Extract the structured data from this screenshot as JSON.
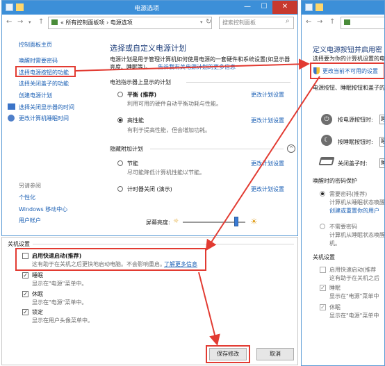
{
  "main_window": {
    "title": "电源选项",
    "breadcrumb": "« 所有控制面板项 › 电源选项",
    "search_placeholder": "搜索控制面板",
    "sidebar": {
      "home": "控制面板主页",
      "items": [
        "唤醒时需要密码",
        "选择电源按钮的功能",
        "选择关闭盖子的功能",
        "创建电源计划",
        "选择关闭显示器的时间",
        "更改计算机睡眠时间"
      ],
      "see_also": "另请参阅",
      "see_also_items": [
        "个性化",
        "Windows 移动中心",
        "用户帐户"
      ]
    },
    "content": {
      "heading": "选择或自定义电源计划",
      "desc_line1": "电源计划是用于管理计算机如何使用电源的一套硬件和系统设置(如显示器",
      "desc_line2": "亮度、睡眠等)。",
      "desc_link": "告诉我有关电源计划的更多信息",
      "section_shown": "电池指示器上显示的计划",
      "section_hidden": "隐藏附加计划",
      "change_settings": "更改计划设置",
      "plans": [
        {
          "name": "平衡 (推荐)",
          "desc": "利用可用的硬件自动平衡功耗与性能。",
          "selected": false
        },
        {
          "name": "高性能",
          "desc": "有利于提高性能，但会增加功耗。",
          "selected": true
        },
        {
          "name": "节能",
          "desc": "尽可能降低计算机性能以节能。",
          "selected": false
        },
        {
          "name": "计时器关闭 (演示)",
          "desc": "",
          "selected": false
        }
      ],
      "brightness_label": "屏幕亮度:",
      "brightness_level": 0.86
    }
  },
  "shutdown_settings": {
    "title": "关机设置",
    "items": [
      {
        "label": "启用快速启动(推荐)",
        "desc": "这有助于在关机之后更快地启动电脑。不会影响重启。",
        "link": "了解更多信息",
        "checked": false
      },
      {
        "label": "睡眠",
        "desc": "显示在\"电源\"菜单中。",
        "checked": true
      },
      {
        "label": "休眠",
        "desc": "显示在\"电源\"菜单中。",
        "checked": true
      },
      {
        "label": "锁定",
        "desc": "显示在用户头像菜单中。",
        "checked": true
      }
    ],
    "save_button": "保存修改",
    "cancel_button": "取消"
  },
  "right_window": {
    "heading_line1": "定义电源按钮并启用密",
    "heading_line2": "选择要为你的计算机设置的电源",
    "admin_link": "更改当前不可用的设置",
    "section_line": "电源按钮、睡眠按钮和盖子的",
    "rows": [
      "按电源按钮时:",
      "按睡眠按钮时:",
      "关闭盖子时:"
    ],
    "password_title": "唤醒时的密码保护",
    "password_required": "需要密码(推荐)",
    "password_required_desc1": "计算机从睡眠状态唤醒",
    "password_required_desc2": "创建或重置你的用户",
    "password_none": "不需要密码",
    "password_none_desc1": "计算机从睡眠状态唤醒",
    "password_none_desc2": "机。",
    "shutdown_title": "关机设置",
    "shutdown_items": [
      {
        "label": "启用快速启动(推荐",
        "desc": "这有助于在关机之后",
        "checked": false
      },
      {
        "label": "睡眠",
        "desc": "显示在\"电源\"菜单中",
        "checked": true
      },
      {
        "label": "休眠",
        "desc": "显示在\"电源\"菜单中",
        "checked": true
      }
    ]
  },
  "colors": {
    "titlebar": "#3c8fd8",
    "highlight": "#e23b32",
    "link": "#1a5fb4"
  }
}
